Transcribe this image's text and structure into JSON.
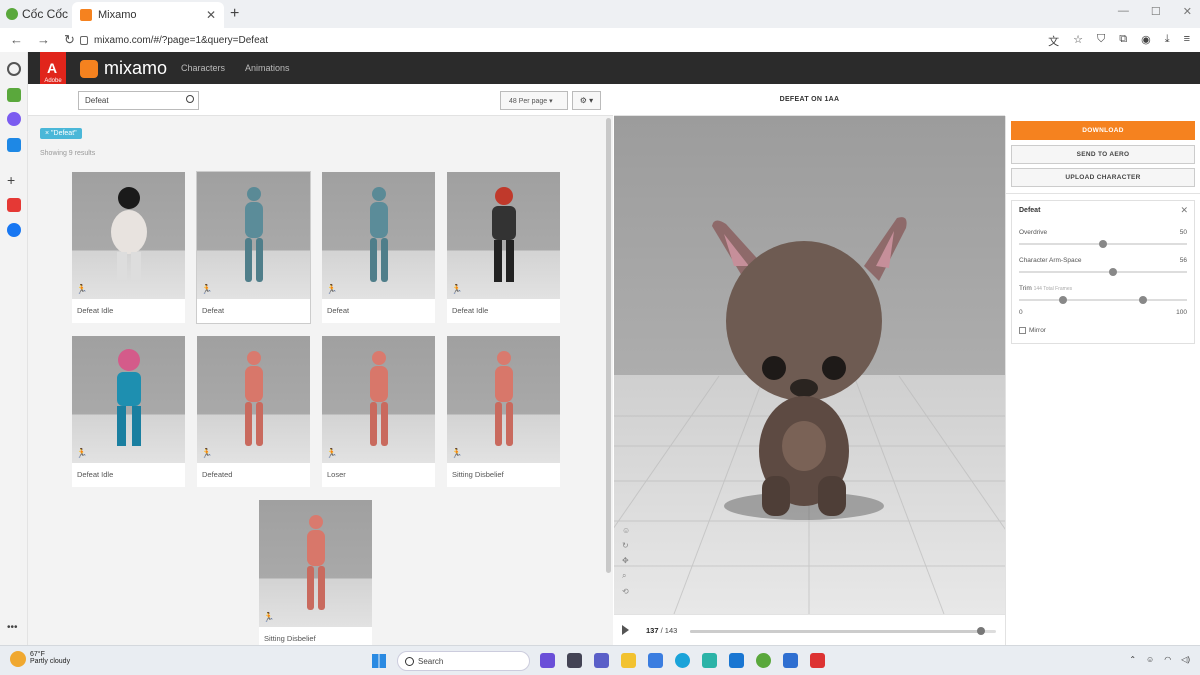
{
  "browser": {
    "brand": "Cốc Cốc",
    "tab_title": "Mixamo",
    "url": "mixamo.com/#/?page=1&query=Defeat"
  },
  "mixamo": {
    "adobe_label": "Adobe",
    "logo_text": "mixamo",
    "nav": [
      "Characters",
      "Animations"
    ]
  },
  "search": {
    "value": "Defeat",
    "per_page": "48 Per page ▾",
    "gear": "⚙ ▾"
  },
  "results": {
    "chip": "× \"Defeat\"",
    "showing": "Showing 9 results",
    "cards": [
      {
        "label": "Defeat Idle",
        "char": "boy"
      },
      {
        "label": "Defeat",
        "char": "blue"
      },
      {
        "label": "Defeat",
        "char": "blue"
      },
      {
        "label": "Defeat Idle",
        "char": "cap"
      },
      {
        "label": "Defeat Idle",
        "char": "clown"
      },
      {
        "label": "Defeated",
        "char": "red"
      },
      {
        "label": "Loser",
        "char": "red"
      },
      {
        "label": "Sitting Disbelief",
        "char": "red"
      },
      {
        "label": "Sitting Disbelief",
        "char": "red"
      }
    ]
  },
  "viewer": {
    "title": "DEFEAT ON 1AA",
    "frame_current": "137",
    "frame_total": "/ 143",
    "progress": 0.95
  },
  "panel": {
    "download": "DOWNLOAD",
    "send": "SEND TO AERO",
    "upload": "UPLOAD CHARACTER",
    "settings_title": "Defeat",
    "overdrive_label": "Overdrive",
    "overdrive_value": "50",
    "overdrive_level": 0.5,
    "armspace_label": "Character Arm-Space",
    "armspace_value": "56",
    "armspace_level": 0.56,
    "trim_label": "Trim",
    "trim_frames": "144 Total Frames",
    "trim_min": "0",
    "trim_max": "100",
    "mirror_label": "Mirror"
  },
  "taskbar": {
    "temp": "67°F",
    "weather": "Partly cloudy",
    "search": "Search"
  },
  "colors": {
    "accent": "#f5821f",
    "chip": "#4ab7d8",
    "header": "#2b2b2b"
  }
}
